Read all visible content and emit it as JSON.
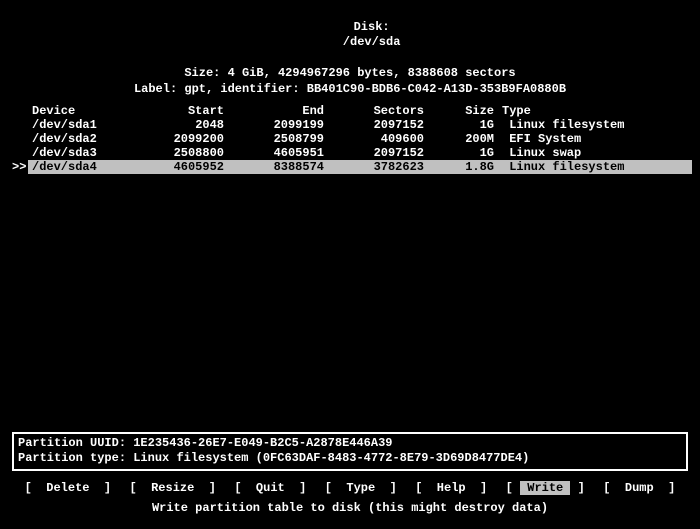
{
  "header": {
    "disk_label": "Disk:",
    "disk_path": "/dev/sda",
    "size_line": "Size: 4 GiB, 4294967296 bytes, 8388608 sectors",
    "label_line": "Label: gpt, identifier: BB401C90-BDB6-C042-A13D-353B9FA0880B"
  },
  "columns": {
    "device": "Device",
    "start": "Start",
    "end": "End",
    "sectors": "Sectors",
    "size": "Size",
    "type": "Type"
  },
  "cursor": ">>",
  "rows": [
    {
      "device": "/dev/sda1",
      "start": "2048",
      "end": "2099199",
      "sectors": "2097152",
      "size": "1G",
      "type": "Linux filesystem",
      "selected": false
    },
    {
      "device": "/dev/sda2",
      "start": "2099200",
      "end": "2508799",
      "sectors": "409600",
      "size": "200M",
      "type": "EFI System",
      "selected": false
    },
    {
      "device": "/dev/sda3",
      "start": "2508800",
      "end": "4605951",
      "sectors": "2097152",
      "size": "1G",
      "type": "Linux swap",
      "selected": false
    },
    {
      "device": "/dev/sda4",
      "start": "4605952",
      "end": "8388574",
      "sectors": "3782623",
      "size": "1.8G",
      "type": "Linux filesystem",
      "selected": true
    }
  ],
  "detail": {
    "uuid_label": "Partition UUID:",
    "uuid": "1E235436-26E7-E049-B2C5-A2878E446A39",
    "ptype_label": "Partition type:",
    "ptype": "Linux filesystem (0FC63DAF-8483-4772-8E79-3D69D8477DE4)"
  },
  "menu": [
    {
      "label": "Delete",
      "selected": false
    },
    {
      "label": "Resize",
      "selected": false
    },
    {
      "label": "Quit",
      "selected": false
    },
    {
      "label": "Type",
      "selected": false
    },
    {
      "label": "Help",
      "selected": false
    },
    {
      "label": "Write",
      "selected": true
    },
    {
      "label": "Dump",
      "selected": false
    }
  ],
  "status": "Write partition table to disk (this might destroy data)"
}
